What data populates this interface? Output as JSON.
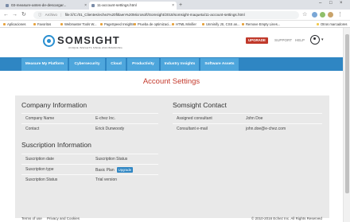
{
  "browser": {
    "tabs": [
      {
        "label": "03-measure-antes-de-descargar...",
        "active": false
      },
      {
        "label": "11-account-settings.html",
        "active": true
      }
    ],
    "address": {
      "label": "Archivo",
      "url": "file:///C:/01_Clientes/echez%20fitlaen%20Microsoft/Somsight/2018/somsight-maqueta/11-account-settings.html"
    },
    "bookmarks": [
      "Aplicaciones",
      "Favoritos",
      "Webmaster Tools W...",
      "PageSpeed Insights",
      "Prueba de optimizaci...",
      "HTML Minifier",
      "Unminify JS, CSS an...",
      "Remove Empty Lines...",
      "Otros marcadores"
    ]
  },
  "header": {
    "logo_text": "SOMSIGHT",
    "logo_tagline": "UNIQUE INSIGHTS SINCE 2013 BRANDING",
    "upgrade_label": "UPGRADE",
    "support_label": "SUPPORT",
    "help_label": "HELP"
  },
  "nav": {
    "tabs": [
      "Measure My Platform",
      "Cybersecurity",
      "Cloud",
      "Productivity",
      "Industry Insights",
      "Software Assets"
    ]
  },
  "page_title": "Account Settings",
  "company": {
    "title": "Company Information",
    "rows": [
      {
        "label": "Company Name",
        "value": "E-chez Inc."
      },
      {
        "label": "Contact",
        "value": "Erick Dunwoody"
      }
    ]
  },
  "contact": {
    "title": "Somsight Contact",
    "rows": [
      {
        "label": "Assigned consultant",
        "value": "John Doe"
      },
      {
        "label": "Consultant e-mail",
        "value": "john.doe@e-chez.com"
      }
    ]
  },
  "subscription": {
    "title": "Suscription Information",
    "rows": [
      {
        "label": "Suscription date",
        "value": "Suscription Status"
      },
      {
        "label": "Suscription type",
        "value": "Basic Plan",
        "button": "Upgrade"
      },
      {
        "label": "Suscription Status",
        "value": "Trial version"
      }
    ]
  },
  "footer": {
    "terms": "Terms of use",
    "privacy": "Privacy and Cookies",
    "copyright": "© 2010-2016 Echez Inc. All Rights Reserved"
  },
  "colors": {
    "accent": "#2f86c3",
    "tab": "#4ea6dc",
    "title": "#c4392c",
    "upgrade": "#c0392b"
  }
}
